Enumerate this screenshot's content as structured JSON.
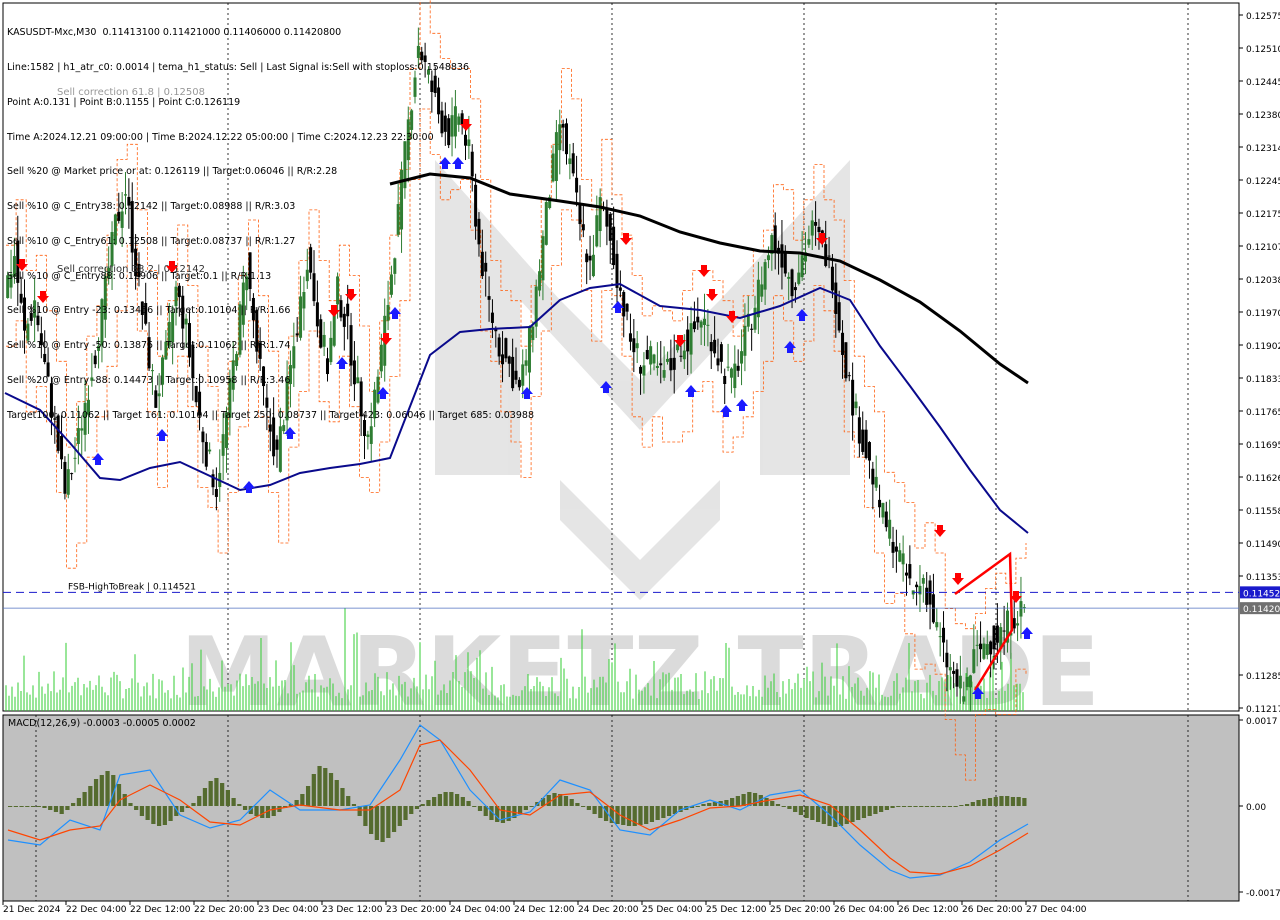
{
  "header": {
    "lines": [
      "KASUSDT-Mxc,M30  0.11413100 0.11421000 0.11406000 0.11420800",
      "Line:1582 | h1_atr_c0: 0.0014 | tema_h1_status: Sell | Last Signal is:Sell with stoploss:0.1548836",
      "Point A:0.131 | Point B:0.1155 | Point C:0.126119",
      "Time A:2024.12.21 09:00:00 | Time B:2024.12.22 05:00:00 | Time C:2024.12.23 22:30:00",
      "Sell %20 @ Market price or at: 0.126119 || Target:0.06046 || R/R:2.28",
      "Sell %10 @ C_Entry38: 0.12142 || Target:0.08988 || R/R:3.03",
      "Sell %10 @ C_Entry61: 0.12508 || Target:0.08737 || R/R:1.27",
      "Sell %10 @ C_Entry88: 0.12906 || Target:0.1 || R/R:1.13",
      "Sell %10 @ Entry -23: 0.13466 || Target:0.10104 || R/R:1.66",
      "Sell %10 @ Entry -50: 0.13875 || Target:0.11062 || R/R:1.74",
      "Sell %20 @ Entry -88: 0.14473 || Target:0.10958 || R/R:3.46",
      "Target100: 0.11062 || Target 161: 0.10104 || Target 250: 0.08737 || Target 423: 0.06046 || Target 685: 0.03988"
    ]
  },
  "labels": {
    "sell_correction": "Sell correction 38.2 | 0.12142",
    "sell_correction_2": "Sell correction 61.8 | 0.12508",
    "fsb": "FSB-HighToBreak | 0.114521",
    "fsb_price": "0.11452",
    "current_price": "0.11420",
    "macd_label": "MACD(12,26,9) -0.0003 -0.0005 0.0002",
    "watermark": "MARKETZ TRADE"
  },
  "colors": {
    "background": "#ffffff",
    "bull_candle": "#2e7d32",
    "bear_candle": "#000000",
    "ema_slow": "#000000",
    "ema_fast": "#0a0a8c",
    "channel": "#ff6010",
    "volume": "#33cc33",
    "macd_hist": "#556b2f",
    "macd_line": "#1e90ff",
    "signal_line": "#ff4500",
    "fsb_line": "#1a1acc",
    "sell_arrow": "#ff0000",
    "buy_arrow": "#1a1aff"
  },
  "chart_data": [
    {
      "type": "candlestick",
      "symbol": "KASUSDT-Mxc",
      "timeframe": "M30",
      "ohlc_last": {
        "open": 0.114131,
        "high": 0.11421,
        "low": 0.11406,
        "close": 0.114208
      },
      "y_ticks": [
        "0.12575",
        "0.12510",
        "0.12445",
        "0.12380",
        "0.12314",
        "0.12245",
        "0.12175",
        "0.12107",
        "0.12038",
        "0.11970",
        "0.11902",
        "0.11833",
        "0.11765",
        "0.11695",
        "0.11626",
        "0.11558",
        "0.11490",
        "0.11353",
        "0.11285",
        "0.11217"
      ],
      "ylim": [
        0.11217,
        0.1262
      ],
      "x_ticks": [
        "21 Dec 2024",
        "22 Dec 04:00",
        "22 Dec 12:00",
        "22 Dec 20:00",
        "23 Dec 04:00",
        "23 Dec 12:00",
        "23 Dec 20:00",
        "24 Dec 04:00",
        "24 Dec 12:00",
        "24 Dec 20:00",
        "25 Dec 04:00",
        "25 Dec 12:00",
        "25 Dec 20:00",
        "26 Dec 04:00",
        "26 Dec 12:00",
        "26 Dec 20:00",
        "27 Dec 04:00"
      ],
      "close_path": [
        0.1205,
        0.1212,
        0.1196,
        0.1203,
        0.119,
        0.1178,
        0.1165,
        0.1172,
        0.1183,
        0.1193,
        0.1205,
        0.1218,
        0.1225,
        0.121,
        0.1196,
        0.1183,
        0.1192,
        0.1205,
        0.1197,
        0.1183,
        0.1173,
        0.1166,
        0.118,
        0.1195,
        0.121,
        0.1193,
        0.118,
        0.1172,
        0.1185,
        0.1198,
        0.1212,
        0.12,
        0.119,
        0.1205,
        0.1197,
        0.1185,
        0.1176,
        0.1188,
        0.1203,
        0.122,
        0.1238,
        0.1254,
        0.1247,
        0.124,
        0.1236,
        0.124,
        0.1232,
        0.1214,
        0.1202,
        0.1194,
        0.119,
        0.1185,
        0.1195,
        0.121,
        0.1225,
        0.1238,
        0.123,
        0.1218,
        0.121,
        0.1222,
        0.1215,
        0.1205,
        0.1195,
        0.1191,
        0.1191,
        0.1188,
        0.119,
        0.1194,
        0.1196,
        0.12,
        0.1196,
        0.119,
        0.1187,
        0.1193,
        0.12,
        0.1208,
        0.1215,
        0.1212,
        0.1206,
        0.1212,
        0.1217,
        0.1214,
        0.1208,
        0.1194,
        0.1183,
        0.1175,
        0.1168,
        0.116,
        0.1156,
        0.115,
        0.1145,
        0.1148,
        0.114,
        0.1133,
        0.1128,
        0.1125,
        0.1132,
        0.1135,
        0.1136,
        0.1138,
        0.1141,
        0.1142
      ],
      "ema_slow_path": [
        [
          390,
          184
        ],
        [
          430,
          174
        ],
        [
          470,
          178
        ],
        [
          510,
          194
        ],
        [
          560,
          201
        ],
        [
          600,
          207
        ],
        [
          640,
          216
        ],
        [
          680,
          232
        ],
        [
          720,
          243
        ],
        [
          760,
          251
        ],
        [
          800,
          253
        ],
        [
          840,
          261
        ],
        [
          880,
          280
        ],
        [
          920,
          302
        ],
        [
          960,
          331
        ],
        [
          1000,
          364
        ],
        [
          1028,
          383
        ]
      ],
      "ema_fast_path": [
        [
          5,
          393
        ],
        [
          40,
          410
        ],
        [
          70,
          443
        ],
        [
          100,
          478
        ],
        [
          120,
          480
        ],
        [
          150,
          468
        ],
        [
          180,
          462
        ],
        [
          210,
          476
        ],
        [
          240,
          490
        ],
        [
          270,
          485
        ],
        [
          300,
          473
        ],
        [
          330,
          468
        ],
        [
          360,
          464
        ],
        [
          390,
          458
        ],
        [
          430,
          355
        ],
        [
          460,
          332
        ],
        [
          490,
          329
        ],
        [
          530,
          327
        ],
        [
          560,
          300
        ],
        [
          590,
          288
        ],
        [
          620,
          284
        ],
        [
          660,
          306
        ],
        [
          700,
          310
        ],
        [
          740,
          318
        ],
        [
          780,
          306
        ],
        [
          820,
          288
        ],
        [
          850,
          300
        ],
        [
          880,
          346
        ],
        [
          910,
          386
        ],
        [
          940,
          427
        ],
        [
          970,
          470
        ],
        [
          1000,
          510
        ],
        [
          1028,
          533
        ]
      ],
      "fsb_level": 0.114521,
      "current_level": 0.114208
    },
    {
      "type": "bar",
      "name": "MACD(12,26,9)",
      "values_summary": {
        "main": -0.0003,
        "signal": -0.0005,
        "hist": 0.0002
      },
      "y_ticks": [
        "0.0017",
        "0.00",
        "-0.0017"
      ],
      "ylim": [
        -0.0019,
        0.0019
      ]
    }
  ]
}
